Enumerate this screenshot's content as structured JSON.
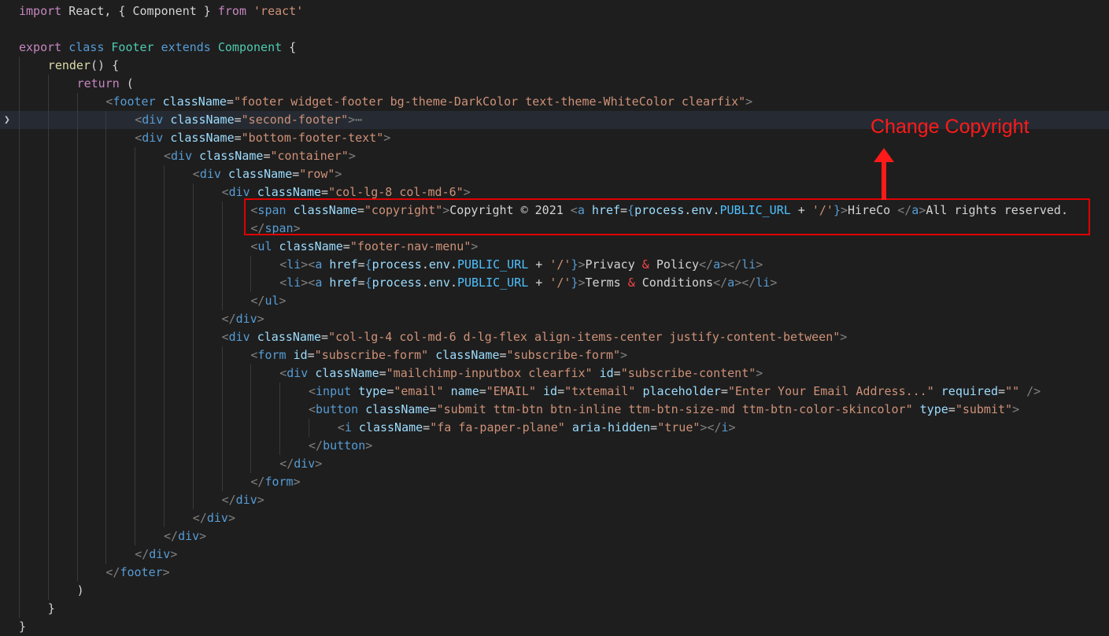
{
  "annotation": {
    "label": "Change Copyright",
    "color": "#ff1a1a"
  },
  "editor": {
    "theme": "dark",
    "lines": [
      {
        "indent": 0,
        "tokens": [
          [
            "kw2",
            "import"
          ],
          [
            "pl",
            " React, { Component } "
          ],
          [
            "kw2",
            "from"
          ],
          [
            "pl",
            " "
          ],
          [
            "str",
            "'react'"
          ]
        ]
      },
      {
        "indent": 0,
        "tokens": []
      },
      {
        "indent": 0,
        "tokens": [
          [
            "kw2",
            "export"
          ],
          [
            "pl",
            " "
          ],
          [
            "kw",
            "class"
          ],
          [
            "pl",
            " "
          ],
          [
            "cls",
            "Footer"
          ],
          [
            "pl",
            " "
          ],
          [
            "kw",
            "extends"
          ],
          [
            "pl",
            " "
          ],
          [
            "cls",
            "Component"
          ],
          [
            "pl",
            " {"
          ]
        ]
      },
      {
        "indent": 1,
        "tokens": [
          [
            "fn",
            "render"
          ],
          [
            "pl",
            "() {"
          ]
        ]
      },
      {
        "indent": 2,
        "tokens": [
          [
            "kw2",
            "return"
          ],
          [
            "pl",
            " ("
          ]
        ]
      },
      {
        "indent": 3,
        "tokens": [
          [
            "brk",
            "<"
          ],
          [
            "tag",
            "footer"
          ],
          [
            "pl",
            " "
          ],
          [
            "attr",
            "className"
          ],
          [
            "pl",
            "="
          ],
          [
            "str",
            "\"footer widget-footer bg-theme-DarkColor text-theme-WhiteColor clearfix\""
          ],
          [
            "brk",
            ">"
          ]
        ]
      },
      {
        "indent": 4,
        "highlight": true,
        "fold": true,
        "tokens": [
          [
            "brk",
            "<"
          ],
          [
            "tag",
            "div"
          ],
          [
            "pl",
            " "
          ],
          [
            "attr",
            "className"
          ],
          [
            "pl",
            "="
          ],
          [
            "str",
            "\"second-footer\""
          ],
          [
            "brk",
            ">"
          ],
          [
            "ellipsis",
            "⋯"
          ]
        ]
      },
      {
        "indent": 4,
        "tokens": [
          [
            "brk",
            "<"
          ],
          [
            "tag",
            "div"
          ],
          [
            "pl",
            " "
          ],
          [
            "attr",
            "className"
          ],
          [
            "pl",
            "="
          ],
          [
            "str",
            "\"bottom-footer-text\""
          ],
          [
            "brk",
            ">"
          ]
        ]
      },
      {
        "indent": 5,
        "tokens": [
          [
            "brk",
            "<"
          ],
          [
            "tag",
            "div"
          ],
          [
            "pl",
            " "
          ],
          [
            "attr",
            "className"
          ],
          [
            "pl",
            "="
          ],
          [
            "str",
            "\"container\""
          ],
          [
            "brk",
            ">"
          ]
        ]
      },
      {
        "indent": 6,
        "tokens": [
          [
            "brk",
            "<"
          ],
          [
            "tag",
            "div"
          ],
          [
            "pl",
            " "
          ],
          [
            "attr",
            "className"
          ],
          [
            "pl",
            "="
          ],
          [
            "str",
            "\"row\""
          ],
          [
            "brk",
            ">"
          ]
        ]
      },
      {
        "indent": 7,
        "tokens": [
          [
            "brk",
            "<"
          ],
          [
            "tag",
            "div"
          ],
          [
            "pl",
            " "
          ],
          [
            "attr",
            "className"
          ],
          [
            "pl",
            "="
          ],
          [
            "str",
            "\"col-lg-8 col-md-6\""
          ],
          [
            "brk",
            ">"
          ]
        ]
      },
      {
        "indent": 8,
        "tokens": [
          [
            "brk",
            "<"
          ],
          [
            "tag",
            "span"
          ],
          [
            "pl",
            " "
          ],
          [
            "attr",
            "className"
          ],
          [
            "pl",
            "="
          ],
          [
            "str",
            "\"copyright\""
          ],
          [
            "brk",
            ">"
          ],
          [
            "pl",
            "Copyright © 2021 "
          ],
          [
            "brk",
            "<"
          ],
          [
            "tag",
            "a"
          ],
          [
            "pl",
            " "
          ],
          [
            "attr",
            "href"
          ],
          [
            "pl",
            "="
          ],
          [
            "kw",
            "{"
          ],
          [
            "var",
            "process"
          ],
          [
            "pl",
            "."
          ],
          [
            "var",
            "env"
          ],
          [
            "pl",
            "."
          ],
          [
            "const",
            "PUBLIC_URL"
          ],
          [
            "pl",
            " + "
          ],
          [
            "str",
            "'/'"
          ],
          [
            "kw",
            "}"
          ],
          [
            "brk",
            ">"
          ],
          [
            "pl",
            "HireCo "
          ],
          [
            "brk",
            "</"
          ],
          [
            "tag",
            "a"
          ],
          [
            "brk",
            ">"
          ],
          [
            "pl",
            "All rights reserved."
          ]
        ]
      },
      {
        "indent": 8,
        "tokens": [
          [
            "brk",
            "</"
          ],
          [
            "tag",
            "span"
          ],
          [
            "brk",
            ">"
          ]
        ]
      },
      {
        "indent": 8,
        "tokens": [
          [
            "brk",
            "<"
          ],
          [
            "tag",
            "ul"
          ],
          [
            "pl",
            " "
          ],
          [
            "attr",
            "className"
          ],
          [
            "pl",
            "="
          ],
          [
            "str",
            "\"footer-nav-menu\""
          ],
          [
            "brk",
            ">"
          ]
        ]
      },
      {
        "indent": 9,
        "tokens": [
          [
            "brk",
            "<"
          ],
          [
            "tag",
            "li"
          ],
          [
            "brk",
            "><"
          ],
          [
            "tag",
            "a"
          ],
          [
            "pl",
            " "
          ],
          [
            "attr",
            "href"
          ],
          [
            "pl",
            "="
          ],
          [
            "kw",
            "{"
          ],
          [
            "var",
            "process"
          ],
          [
            "pl",
            "."
          ],
          [
            "var",
            "env"
          ],
          [
            "pl",
            "."
          ],
          [
            "const",
            "PUBLIC_URL"
          ],
          [
            "pl",
            " + "
          ],
          [
            "str",
            "'/'"
          ],
          [
            "kw",
            "}"
          ],
          [
            "brk",
            ">"
          ],
          [
            "pl",
            "Privacy "
          ],
          [
            "ent",
            "&"
          ],
          [
            "pl",
            " Policy"
          ],
          [
            "brk",
            "</"
          ],
          [
            "tag",
            "a"
          ],
          [
            "brk",
            "></"
          ],
          [
            "tag",
            "li"
          ],
          [
            "brk",
            ">"
          ]
        ]
      },
      {
        "indent": 9,
        "tokens": [
          [
            "brk",
            "<"
          ],
          [
            "tag",
            "li"
          ],
          [
            "brk",
            "><"
          ],
          [
            "tag",
            "a"
          ],
          [
            "pl",
            " "
          ],
          [
            "attr",
            "href"
          ],
          [
            "pl",
            "="
          ],
          [
            "kw",
            "{"
          ],
          [
            "var",
            "process"
          ],
          [
            "pl",
            "."
          ],
          [
            "var",
            "env"
          ],
          [
            "pl",
            "."
          ],
          [
            "const",
            "PUBLIC_URL"
          ],
          [
            "pl",
            " + "
          ],
          [
            "str",
            "'/'"
          ],
          [
            "kw",
            "}"
          ],
          [
            "brk",
            ">"
          ],
          [
            "pl",
            "Terms "
          ],
          [
            "ent",
            "&"
          ],
          [
            "pl",
            " Conditions"
          ],
          [
            "brk",
            "</"
          ],
          [
            "tag",
            "a"
          ],
          [
            "brk",
            "></"
          ],
          [
            "tag",
            "li"
          ],
          [
            "brk",
            ">"
          ]
        ]
      },
      {
        "indent": 8,
        "tokens": [
          [
            "brk",
            "</"
          ],
          [
            "tag",
            "ul"
          ],
          [
            "brk",
            ">"
          ]
        ]
      },
      {
        "indent": 7,
        "tokens": [
          [
            "brk",
            "</"
          ],
          [
            "tag",
            "div"
          ],
          [
            "brk",
            ">"
          ]
        ]
      },
      {
        "indent": 7,
        "tokens": [
          [
            "brk",
            "<"
          ],
          [
            "tag",
            "div"
          ],
          [
            "pl",
            " "
          ],
          [
            "attr",
            "className"
          ],
          [
            "pl",
            "="
          ],
          [
            "str",
            "\"col-lg-4 col-md-6 d-lg-flex align-items-center justify-content-between\""
          ],
          [
            "brk",
            ">"
          ]
        ]
      },
      {
        "indent": 8,
        "tokens": [
          [
            "brk",
            "<"
          ],
          [
            "tag",
            "form"
          ],
          [
            "pl",
            " "
          ],
          [
            "attr",
            "id"
          ],
          [
            "pl",
            "="
          ],
          [
            "str",
            "\"subscribe-form\""
          ],
          [
            "pl",
            " "
          ],
          [
            "attr",
            "className"
          ],
          [
            "pl",
            "="
          ],
          [
            "str",
            "\"subscribe-form\""
          ],
          [
            "brk",
            ">"
          ]
        ]
      },
      {
        "indent": 9,
        "tokens": [
          [
            "brk",
            "<"
          ],
          [
            "tag",
            "div"
          ],
          [
            "pl",
            " "
          ],
          [
            "attr",
            "className"
          ],
          [
            "pl",
            "="
          ],
          [
            "str",
            "\"mailchimp-inputbox clearfix\""
          ],
          [
            "pl",
            " "
          ],
          [
            "attr",
            "id"
          ],
          [
            "pl",
            "="
          ],
          [
            "str",
            "\"subscribe-content\""
          ],
          [
            "brk",
            ">"
          ]
        ]
      },
      {
        "indent": 10,
        "tokens": [
          [
            "brk",
            "<"
          ],
          [
            "tag",
            "input"
          ],
          [
            "pl",
            " "
          ],
          [
            "attr",
            "type"
          ],
          [
            "pl",
            "="
          ],
          [
            "str",
            "\"email\""
          ],
          [
            "pl",
            " "
          ],
          [
            "attr",
            "name"
          ],
          [
            "pl",
            "="
          ],
          [
            "str",
            "\"EMAIL\""
          ],
          [
            "pl",
            " "
          ],
          [
            "attr",
            "id"
          ],
          [
            "pl",
            "="
          ],
          [
            "str",
            "\"txtemail\""
          ],
          [
            "pl",
            " "
          ],
          [
            "attr",
            "placeholder"
          ],
          [
            "pl",
            "="
          ],
          [
            "str",
            "\"Enter Your Email Address...\""
          ],
          [
            "pl",
            " "
          ],
          [
            "attr",
            "required"
          ],
          [
            "pl",
            "="
          ],
          [
            "str",
            "\"\""
          ],
          [
            "pl",
            " "
          ],
          [
            "brk",
            "/>"
          ]
        ]
      },
      {
        "indent": 10,
        "tokens": [
          [
            "brk",
            "<"
          ],
          [
            "tag",
            "button"
          ],
          [
            "pl",
            " "
          ],
          [
            "attr",
            "className"
          ],
          [
            "pl",
            "="
          ],
          [
            "str",
            "\"submit ttm-btn btn-inline ttm-btn-size-md ttm-btn-color-skincolor\""
          ],
          [
            "pl",
            " "
          ],
          [
            "attr",
            "type"
          ],
          [
            "pl",
            "="
          ],
          [
            "str",
            "\"submit\""
          ],
          [
            "brk",
            ">"
          ]
        ]
      },
      {
        "indent": 11,
        "tokens": [
          [
            "brk",
            "<"
          ],
          [
            "tag",
            "i"
          ],
          [
            "pl",
            " "
          ],
          [
            "attr",
            "className"
          ],
          [
            "pl",
            "="
          ],
          [
            "str",
            "\"fa fa-paper-plane\""
          ],
          [
            "pl",
            " "
          ],
          [
            "attr",
            "aria-hidden"
          ],
          [
            "pl",
            "="
          ],
          [
            "str",
            "\"true\""
          ],
          [
            "brk",
            "></"
          ],
          [
            "tag",
            "i"
          ],
          [
            "brk",
            ">"
          ]
        ]
      },
      {
        "indent": 10,
        "tokens": [
          [
            "brk",
            "</"
          ],
          [
            "tag",
            "button"
          ],
          [
            "brk",
            ">"
          ]
        ]
      },
      {
        "indent": 9,
        "tokens": [
          [
            "brk",
            "</"
          ],
          [
            "tag",
            "div"
          ],
          [
            "brk",
            ">"
          ]
        ]
      },
      {
        "indent": 8,
        "tokens": [
          [
            "brk",
            "</"
          ],
          [
            "tag",
            "form"
          ],
          [
            "brk",
            ">"
          ]
        ]
      },
      {
        "indent": 7,
        "tokens": [
          [
            "brk",
            "</"
          ],
          [
            "tag",
            "div"
          ],
          [
            "brk",
            ">"
          ]
        ]
      },
      {
        "indent": 6,
        "tokens": [
          [
            "brk",
            "</"
          ],
          [
            "tag",
            "div"
          ],
          [
            "brk",
            ">"
          ]
        ]
      },
      {
        "indent": 5,
        "tokens": [
          [
            "brk",
            "</"
          ],
          [
            "tag",
            "div"
          ],
          [
            "brk",
            ">"
          ]
        ]
      },
      {
        "indent": 4,
        "tokens": [
          [
            "brk",
            "</"
          ],
          [
            "tag",
            "div"
          ],
          [
            "brk",
            ">"
          ]
        ]
      },
      {
        "indent": 3,
        "tokens": [
          [
            "brk",
            "</"
          ],
          [
            "tag",
            "footer"
          ],
          [
            "brk",
            ">"
          ]
        ]
      },
      {
        "indent": 2,
        "tokens": [
          [
            "pl",
            ")"
          ]
        ]
      },
      {
        "indent": 1,
        "tokens": [
          [
            "pl",
            "}"
          ]
        ]
      },
      {
        "indent": 0,
        "tokens": [
          [
            "pl",
            "}"
          ]
        ]
      }
    ]
  }
}
